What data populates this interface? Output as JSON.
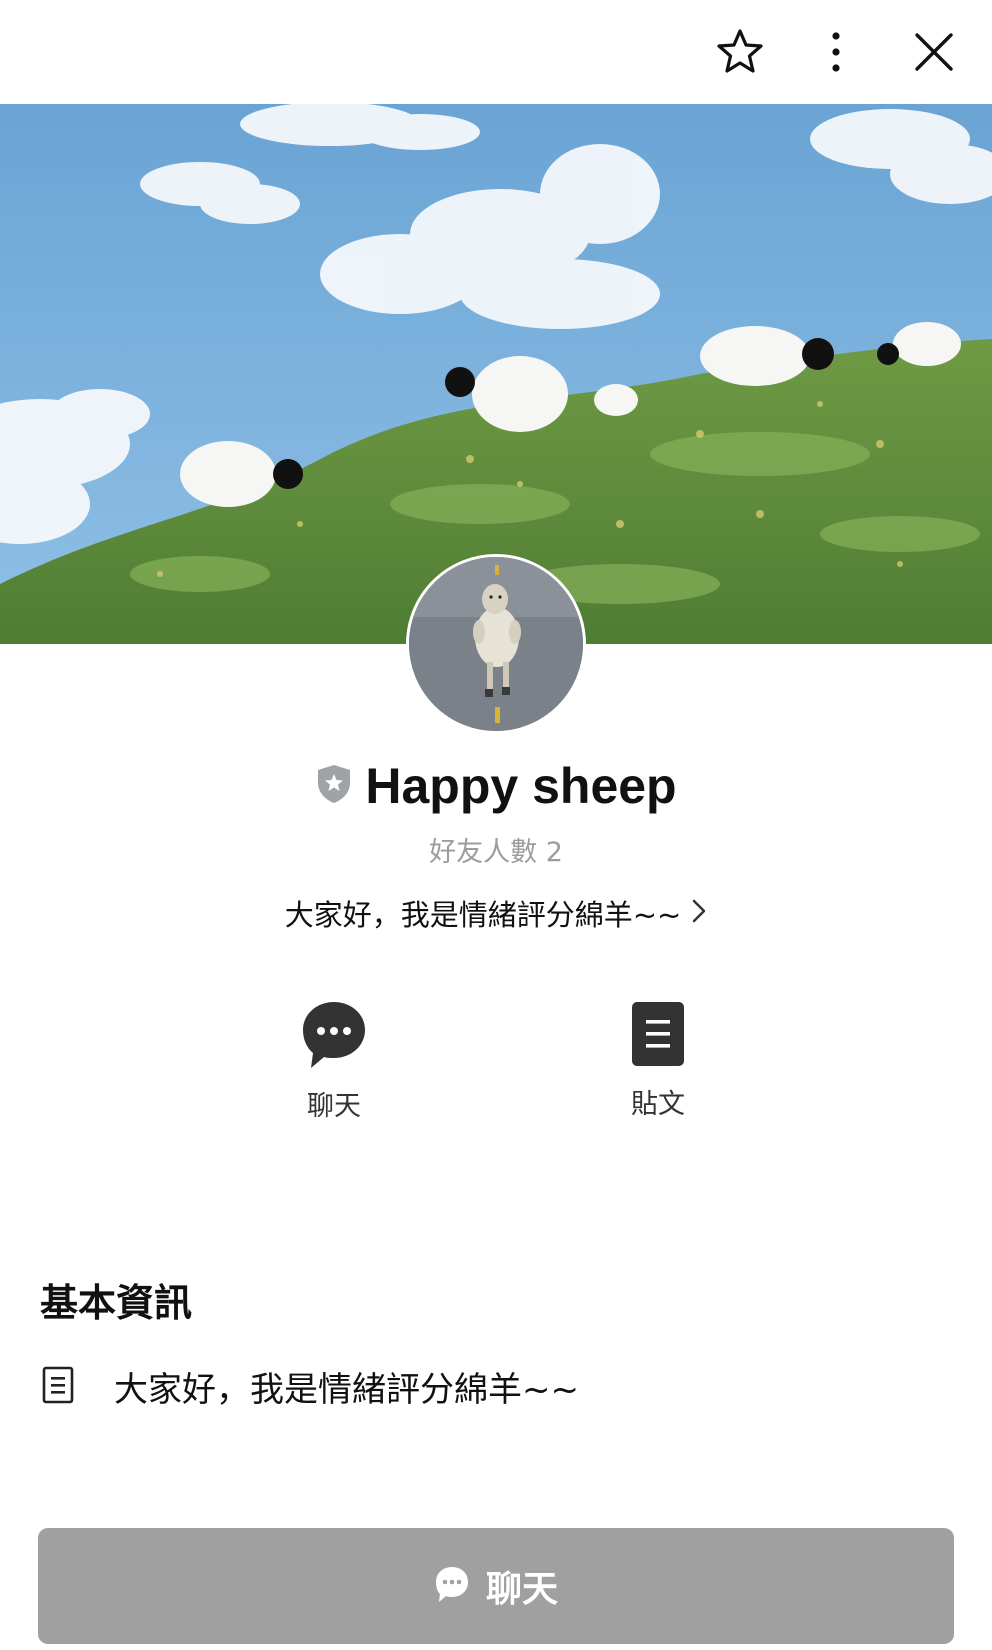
{
  "profile": {
    "name": "Happy sheep",
    "friend_count": "好友人數 2",
    "status_message": "大家好，我是情緒評分綿羊~~"
  },
  "actions": {
    "chat_label": "聊天",
    "posts_label": "貼文"
  },
  "basic_info": {
    "title": "基本資訊",
    "description": "大家好，我是情緒評分綿羊~~"
  },
  "bottom_button": {
    "label": "聊天"
  },
  "icons": {
    "top_bar": [
      "star-icon",
      "more-vertical-icon",
      "close-icon"
    ],
    "badge": "shield-badge-icon",
    "chat": "chat-bubble-icon",
    "posts": "document-icon",
    "info": "document-outline-icon"
  },
  "colors": {
    "bottom_button_bg": "#a0a0a0",
    "action_icon": "#333333",
    "friend_count_text": "#9c9c9c",
    "badge": "#9ea3a8"
  }
}
